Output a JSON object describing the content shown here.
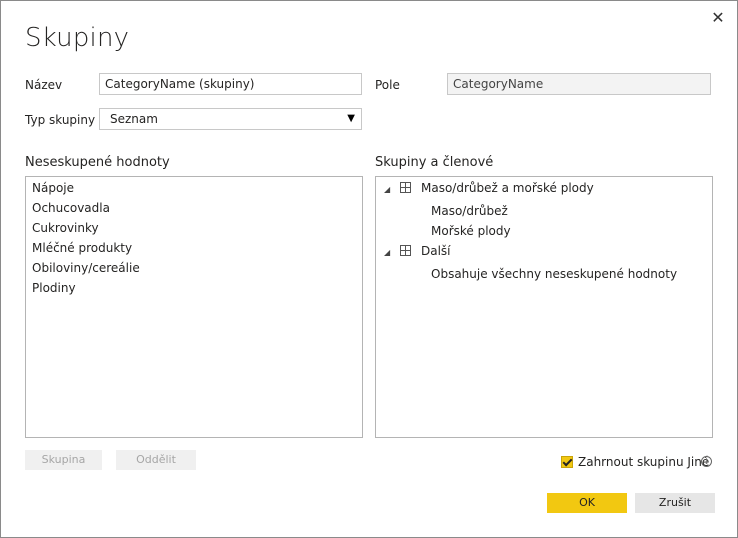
{
  "dialog": {
    "title": "Skupiny",
    "close_glyph": "✕"
  },
  "form": {
    "name_label": "Název",
    "name_value": "CategoryName (skupiny)",
    "field_label": "Pole",
    "field_value": "CategoryName",
    "type_label": "Typ skupiny",
    "type_value": "Seznam"
  },
  "ungrouped": {
    "title": "Neseskupené hodnoty",
    "items": [
      "Nápoje",
      "Ochucovadla",
      "Cukrovinky",
      "Mléčné produkty",
      "Obiloviny/cereálie",
      "Plodiny"
    ]
  },
  "groups": {
    "title": "Skupiny a členové",
    "tree": [
      {
        "label": "Maso/drůbež a mořské plody",
        "members": [
          "Maso/drůbež",
          "Mořské plody"
        ]
      },
      {
        "label": "Další",
        "members": [
          "Obsahuje všechny neseskupené hodnoty"
        ]
      }
    ]
  },
  "buttons": {
    "group": "Skupina",
    "ungroup": "Oddělit",
    "ok": "OK",
    "cancel": "Zrušit"
  },
  "include_other": {
    "label": "Zahrnout skupinu Jiné",
    "checked": true,
    "info_glyph": "i"
  },
  "colors": {
    "accent": "#f2c811"
  }
}
